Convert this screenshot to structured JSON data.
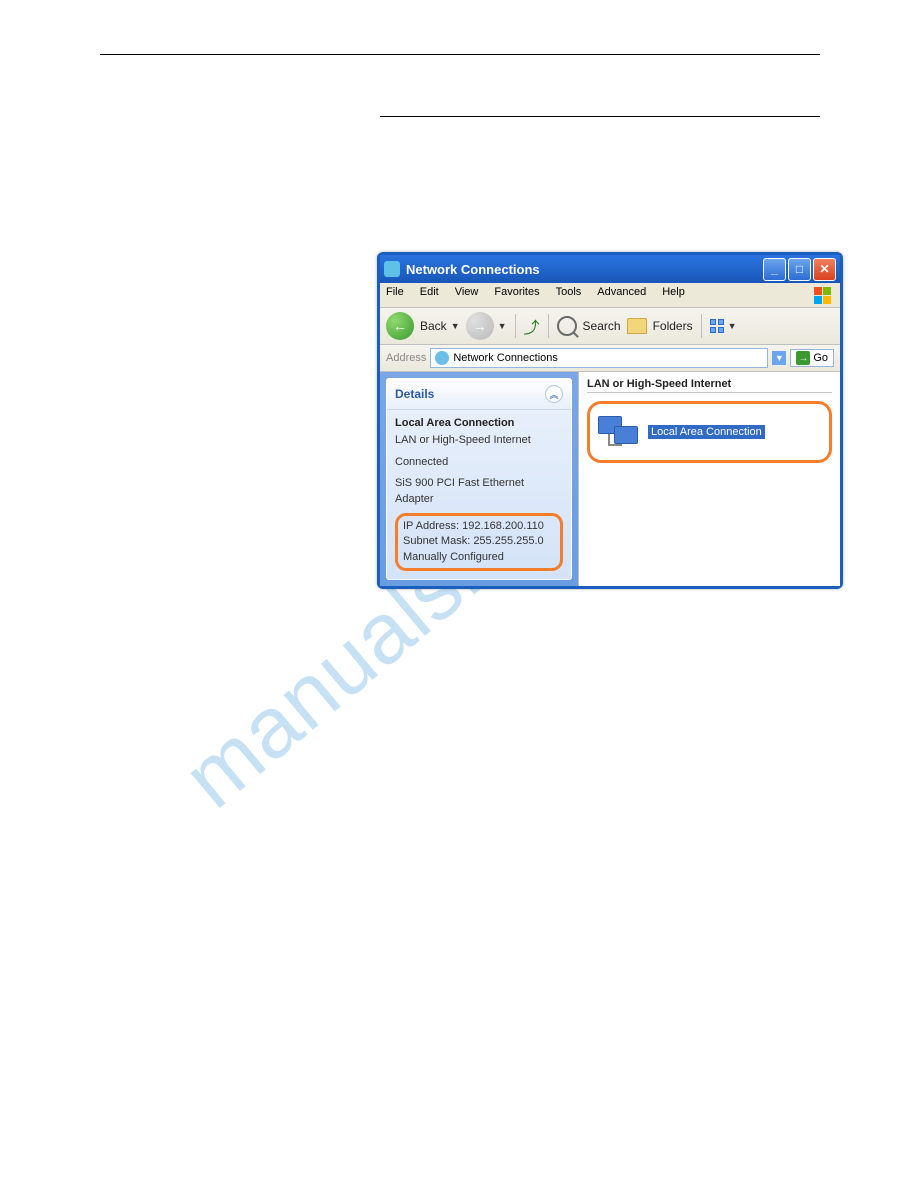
{
  "watermark": "manualshive.com",
  "window": {
    "title": "Network Connections",
    "menu": [
      "File",
      "Edit",
      "View",
      "Favorites",
      "Tools",
      "Advanced",
      "Help"
    ],
    "toolbar": {
      "back_label": "Back",
      "search_label": "Search",
      "folders_label": "Folders"
    },
    "addressbar": {
      "label": "Address",
      "value": "Network Connections",
      "go_label": "Go"
    }
  },
  "details": {
    "header": "Details",
    "connection_name": "Local Area Connection",
    "type": "LAN or High-Speed Internet",
    "status": "Connected",
    "adapter": "SiS 900 PCI Fast Ethernet Adapter",
    "ip_line": "IP Address: 192.168.200.110",
    "mask_line": "Subnet Mask: 255.255.255.0",
    "config_line": "Manually Configured"
  },
  "main": {
    "section_header": "LAN or High-Speed Internet",
    "item_label": "Local Area Connection"
  }
}
